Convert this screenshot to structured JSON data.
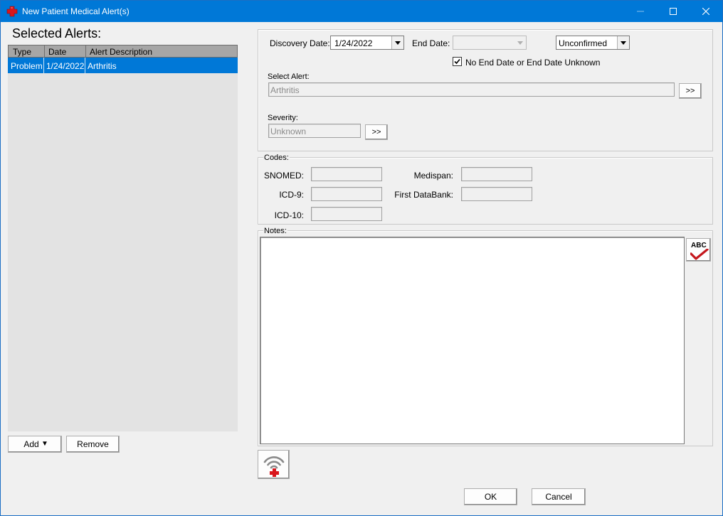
{
  "window": {
    "title": "New Patient Medical Alert(s)",
    "icons": {
      "app": "medical-cross-icon",
      "minimize": "minimize-icon",
      "maximize": "maximize-icon",
      "close": "close-icon"
    }
  },
  "selected_alerts": {
    "heading": "Selected Alerts:",
    "columns": [
      "Type",
      "Date",
      "Alert Description"
    ],
    "rows": [
      {
        "type": "Problem",
        "date": "1/24/2022",
        "description": "Arthritis"
      }
    ],
    "add_label": "Add",
    "add_arrow": "▼",
    "remove_label": "Remove"
  },
  "alert_details": {
    "discovery_date_label": "Discovery Date:",
    "discovery_date_value": "1/24/2022",
    "end_date_label": "End Date:",
    "end_date_value": "",
    "status_value": "Unconfirmed",
    "no_end_date_label": "No End Date or End Date Unknown",
    "no_end_date_checked": true,
    "select_alert_label": "Select Alert:",
    "select_alert_value": "Arthritis",
    "browse_label": ">>",
    "severity_label": "Severity:",
    "severity_value": "Unknown"
  },
  "codes": {
    "legend": "Codes:",
    "snomed_label": "SNOMED:",
    "icd9_label": "ICD-9:",
    "icd10_label": "ICD-10:",
    "medispan_label": "Medispan:",
    "fdb_label": "First DataBank:"
  },
  "notes": {
    "legend": "Notes:",
    "value": "",
    "spellcheck_text": "ABC"
  },
  "footer": {
    "ok_label": "OK",
    "cancel_label": "Cancel"
  },
  "colors": {
    "titlebar": "#0078d7",
    "selection": "#0078d7",
    "accent_red": "#d9161c"
  }
}
